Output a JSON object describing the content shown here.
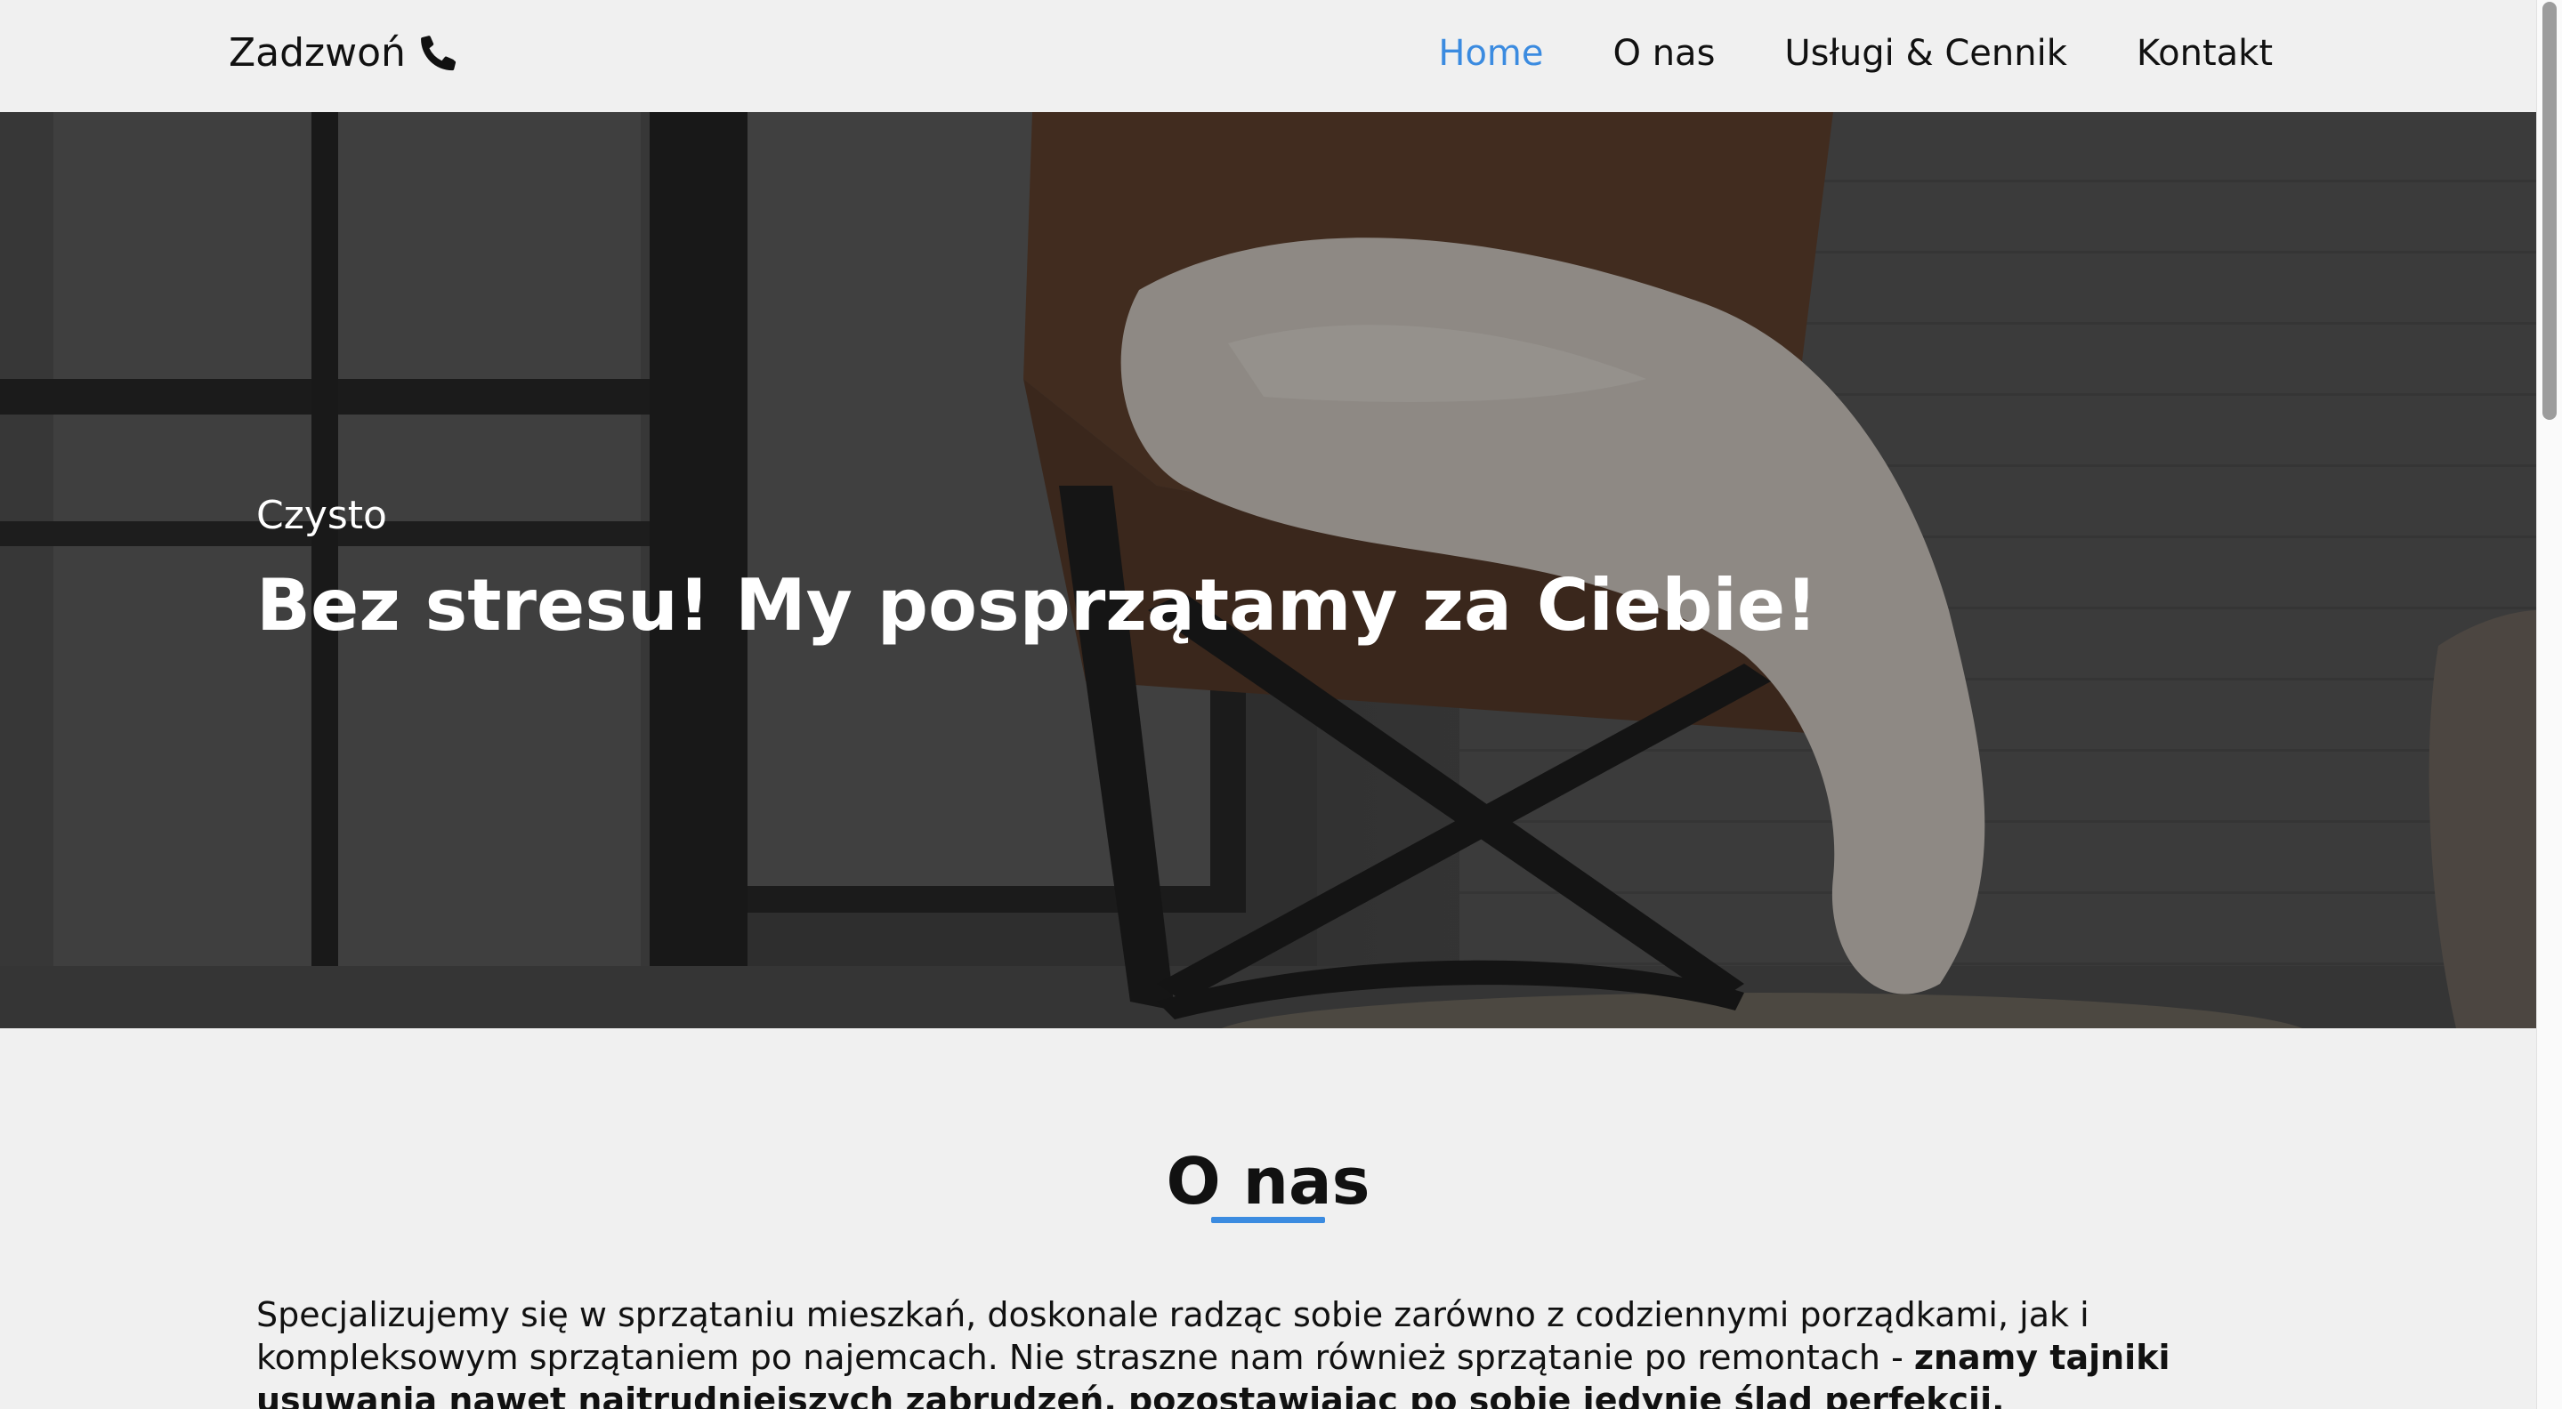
{
  "header": {
    "call_label": "Zadzwoń",
    "call_icon": "phone-icon",
    "nav": [
      {
        "label": "Home",
        "active": true
      },
      {
        "label": "O nas",
        "active": false
      },
      {
        "label": "Usługi & Cennik",
        "active": false
      },
      {
        "label": "Kontakt",
        "active": false
      }
    ]
  },
  "hero": {
    "kicker": "Czysto",
    "title": "Bez stresu! My posprzątamy za Ciebie!"
  },
  "about": {
    "title": "O nas",
    "text_regular": "Specjalizujemy się w sprzątaniu mieszkań, doskonale radząc sobie zarówno z codziennymi porządkami, jak i kompleksowym sprzątaniem po najemcach. Nie straszne nam również sprzątanie po remontach - ",
    "text_bold": "znamy tajniki usuwania nawet najtrudniejszych zabrudzeń, pozostawiając po sobie jedynie ślad perfekcji."
  },
  "colors": {
    "accent": "#3b8be0",
    "background": "#f0f0f0",
    "text": "#111111"
  }
}
